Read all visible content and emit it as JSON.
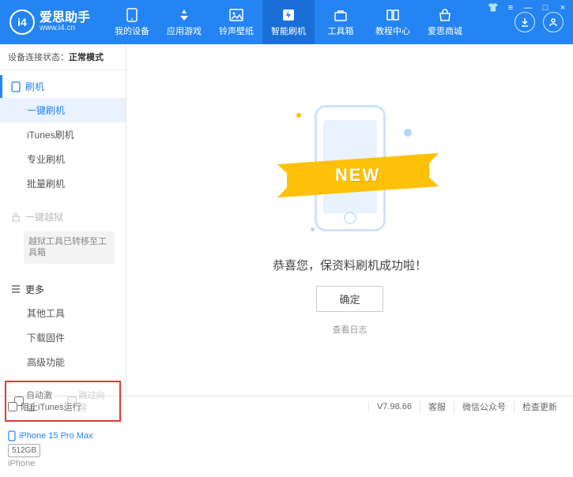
{
  "app": {
    "title": "爱思助手",
    "subtitle": "www.i4.cn"
  },
  "nav": {
    "items": [
      {
        "label": "我的设备"
      },
      {
        "label": "应用游戏"
      },
      {
        "label": "铃声壁纸"
      },
      {
        "label": "智能刷机"
      },
      {
        "label": "工具箱"
      },
      {
        "label": "教程中心"
      },
      {
        "label": "爱思商城"
      }
    ]
  },
  "sidebar": {
    "conn_label": "设备连接状态：",
    "conn_value": "正常模式",
    "section_flash": "刷机",
    "items_flash": [
      "一键刷机",
      "iTunes刷机",
      "专业刷机",
      "批量刷机"
    ],
    "section_jailbreak": "一键越狱",
    "jailbreak_note": "越狱工具已转移至工具箱",
    "section_more": "更多",
    "items_more": [
      "其他工具",
      "下载固件",
      "高级功能"
    ],
    "chk_auto": "自动激活",
    "chk_skip": "跳过向导",
    "device_name": "iPhone 15 Pro Max",
    "device_storage": "512GB",
    "device_model": "iPhone"
  },
  "main": {
    "ribbon": "NEW",
    "success": "恭喜您，保资料刷机成功啦！",
    "ok": "确定",
    "view_log": "查看日志"
  },
  "status": {
    "block_itunes": "阻止iTunes运行",
    "version": "V7.98.66",
    "svc": "客服",
    "wechat": "微信公众号",
    "update": "检查更新"
  }
}
